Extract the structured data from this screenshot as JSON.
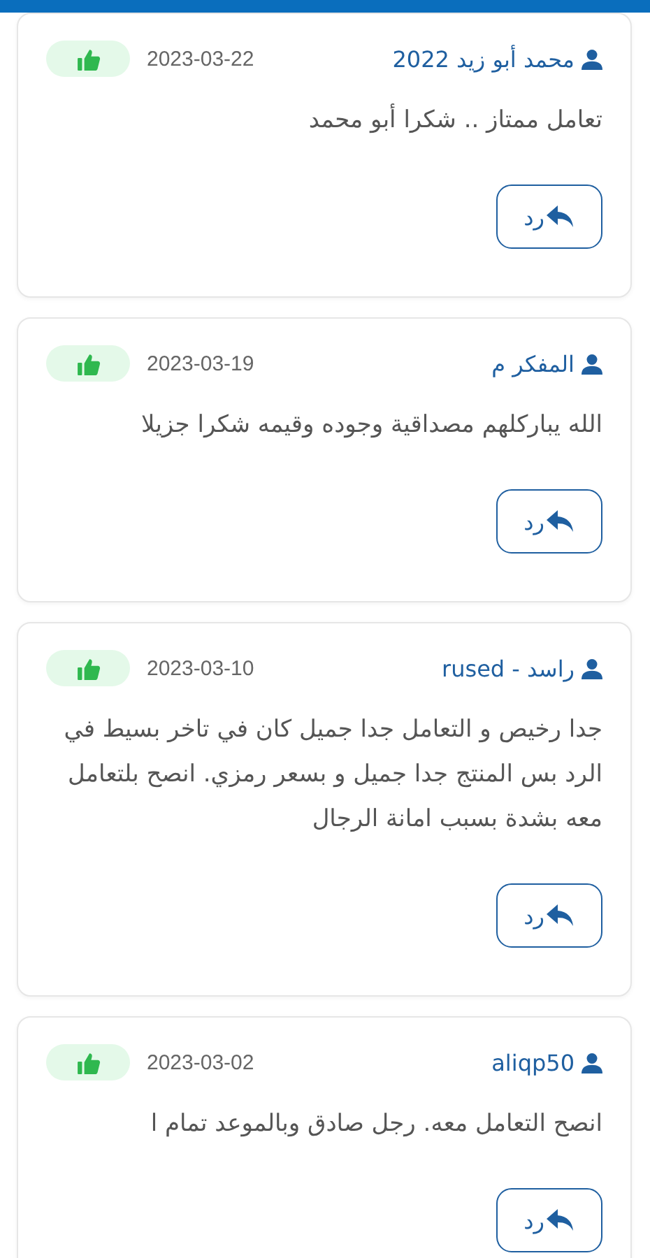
{
  "reviews": [
    {
      "author": "محمد أبو زيد 2022",
      "date": "2023-03-22",
      "liked": true,
      "text": "تعامل ممتاز .. شكرا أبو محمد",
      "reply_label": "رد"
    },
    {
      "author": "المفكر م",
      "date": "2023-03-19",
      "liked": true,
      "text": "الله يباركلهم مصداقية وجوده وقيمه شكرا جزيلا",
      "reply_label": "رد"
    },
    {
      "author": "راسد - rused",
      "date": "2023-03-10",
      "liked": true,
      "text": "جدا رخيص و التعامل جدا جميل كان في تاخر بسيط في الرد بس المنتج جدا جميل و بسعر رمزي. انصح بلتعامل معه بشدة بسبب امانة الرجال",
      "reply_label": "رد"
    },
    {
      "author": "aliqp50",
      "date": "2023-03-02",
      "liked": true,
      "text": "انصح التعامل معه. رجل صادق وبالموعد تمام ا",
      "reply_label": "رد"
    }
  ]
}
